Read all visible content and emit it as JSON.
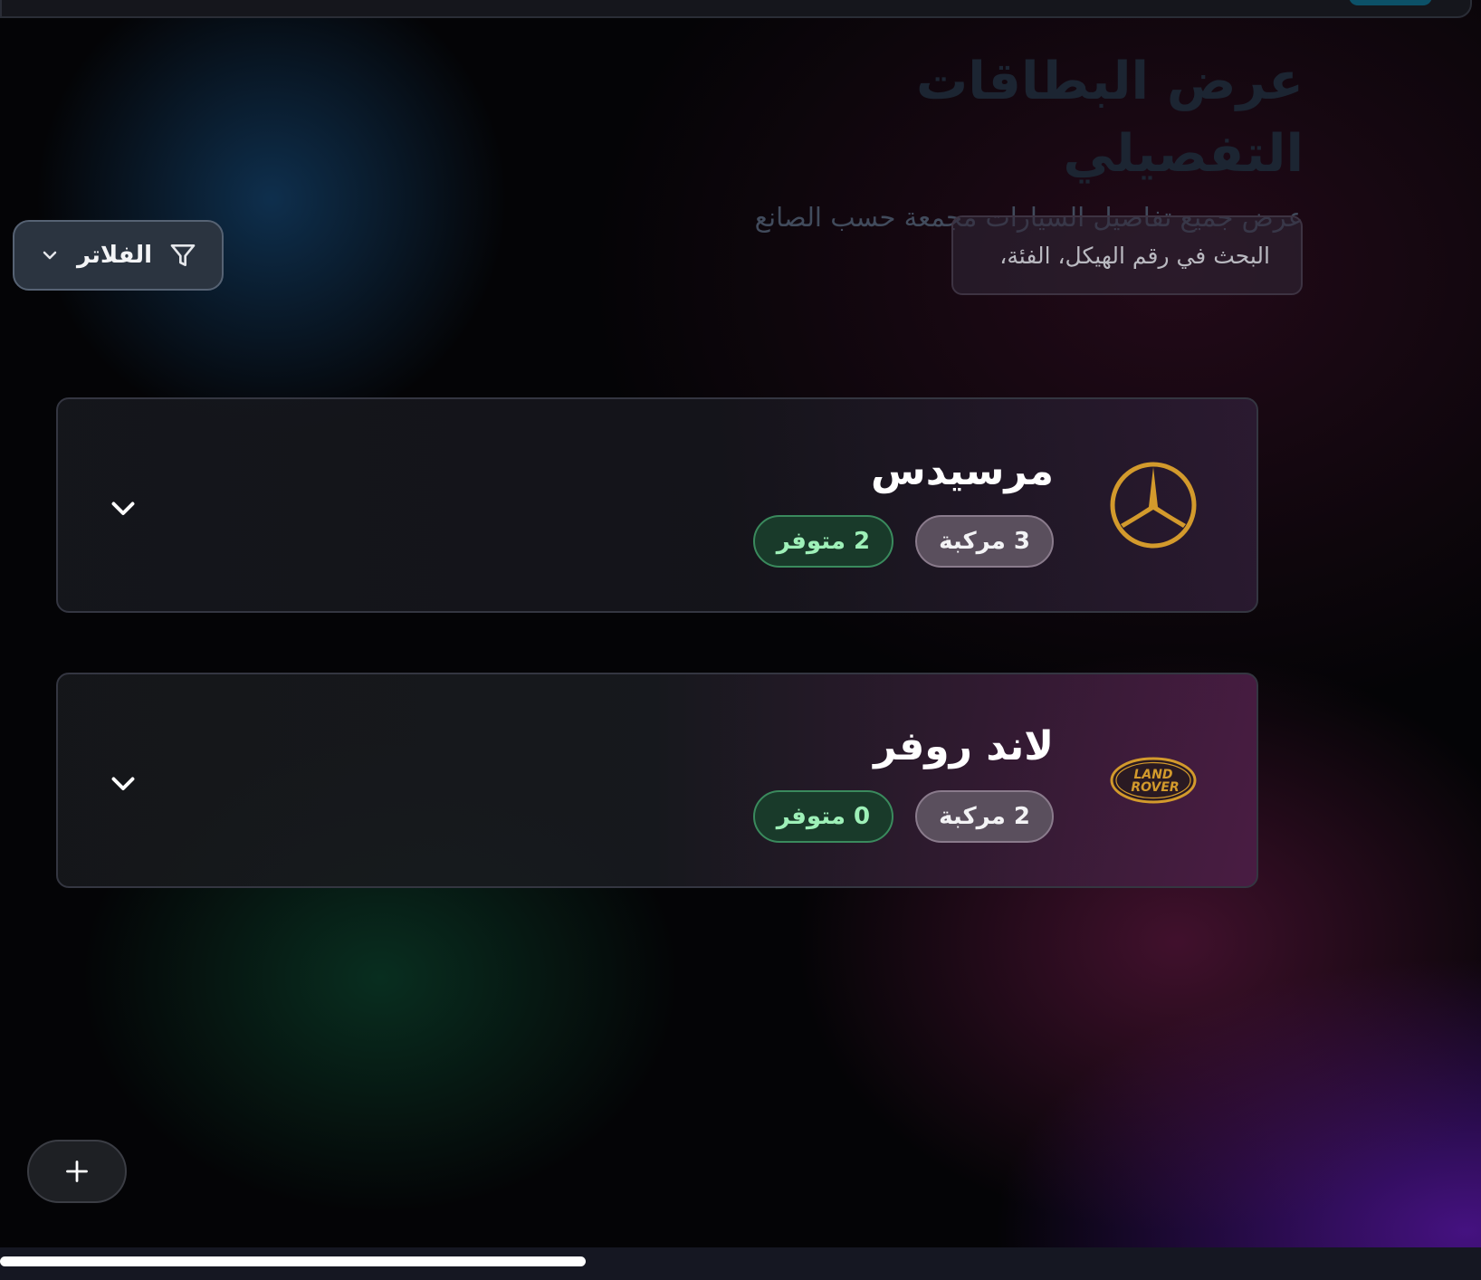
{
  "header": {
    "title": "عرض البطاقات التفصيلي",
    "subtitle": "عرض جميع تفاصيل السيارات مجمعة حسب الصانع"
  },
  "search": {
    "placeholder": "البحث في رقم الهيكل، الفئة،"
  },
  "filters": {
    "label": "الفلاتر"
  },
  "brands": [
    {
      "name": "مرسيدس",
      "logo_icon": "mercedes-star-logo",
      "count_label": "3 مركبة",
      "available_label": "2 متوفر"
    },
    {
      "name": "لاند روفر",
      "logo_icon": "land-rover-logo",
      "logo_text_line1": "LAND",
      "logo_text_line2": "ROVER",
      "count_label": "2 مركبة",
      "available_label": "0 متوفر"
    }
  ],
  "colors": {
    "logo_gold": "#d39a2c",
    "available_green": "#9ef0b8",
    "topbar_badge": "#0c5168"
  },
  "fab": {
    "icon": "plus-icon"
  }
}
